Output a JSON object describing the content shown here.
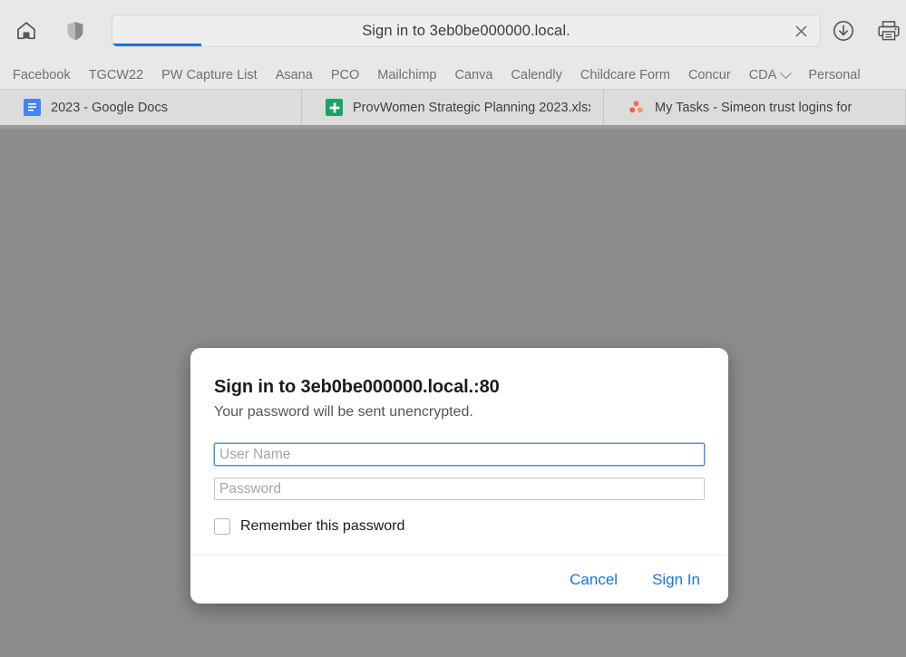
{
  "browser": {
    "toolbar": {
      "home_icon": "home-icon",
      "shield_icon": "shield-icon",
      "address_title": "Sign in to 3eb0be000000.local.",
      "address_close_icon": "close-icon",
      "download_icon": "download-icon",
      "print_icon": "print-icon",
      "progress_percent": 12.6
    },
    "bookmarks": [
      {
        "label": "Facebook",
        "has_menu": false
      },
      {
        "label": "TGCW22",
        "has_menu": false
      },
      {
        "label": "PW Capture List",
        "has_menu": false
      },
      {
        "label": "Asana",
        "has_menu": false
      },
      {
        "label": "PCO",
        "has_menu": false
      },
      {
        "label": "Mailchimp",
        "has_menu": false
      },
      {
        "label": "Canva",
        "has_menu": false
      },
      {
        "label": "Calendly",
        "has_menu": false
      },
      {
        "label": "Childcare Form",
        "has_menu": false
      },
      {
        "label": "Concur",
        "has_menu": false
      },
      {
        "label": "CDA",
        "has_menu": true
      },
      {
        "label": "Personal",
        "has_menu": false
      }
    ],
    "tabs": [
      {
        "title": "2023 - Google Docs",
        "icon": "google-docs-icon"
      },
      {
        "title": "ProvWomen Strategic Planning 2023.xlsx...",
        "icon": "google-sheets-icon"
      },
      {
        "title": "My Tasks - Simeon trust logins for",
        "icon": "asana-icon"
      }
    ]
  },
  "dialog": {
    "title": "Sign in to 3eb0be000000.local.:80",
    "subtitle": "Your password will be sent unencrypted.",
    "username_placeholder": "User Name",
    "username_value": "",
    "password_placeholder": "Password",
    "password_value": "",
    "remember_label": "Remember this password",
    "remember_checked": false,
    "cancel_label": "Cancel",
    "signin_label": "Sign In"
  },
  "colors": {
    "accent_blue": "#1a73e8",
    "focus_blue": "#4a90e2",
    "chrome_grey": "#e8e8e8",
    "page_grey": "#8c8c8c"
  }
}
